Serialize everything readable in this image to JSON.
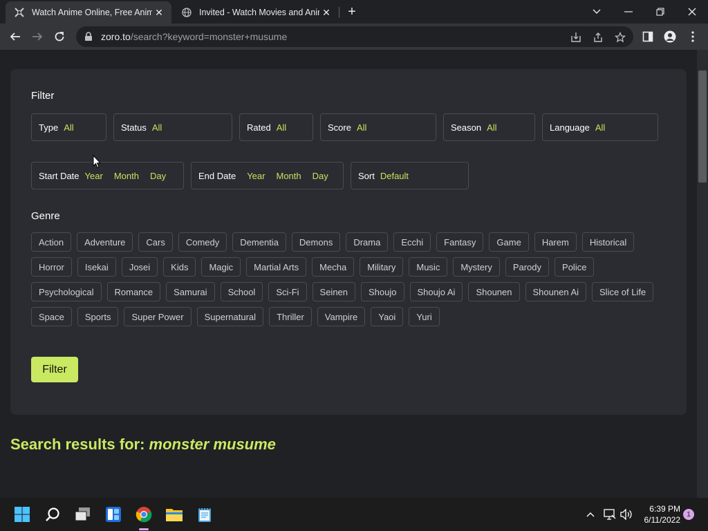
{
  "browser": {
    "tabs": [
      {
        "title": "Watch Anime Online, Free Anime",
        "icon": "zoro-favicon",
        "active": true
      },
      {
        "title": "Invited - Watch Movies and Anim",
        "icon": "globe-icon",
        "active": false
      }
    ],
    "url_host": "zoro.to",
    "url_path": "/search?keyword=monster+musume"
  },
  "filter": {
    "title": "Filter",
    "row1": [
      {
        "label": "Type",
        "value": "All"
      },
      {
        "label": "Status",
        "value": "All"
      },
      {
        "label": "Rated",
        "value": "All"
      },
      {
        "label": "Score",
        "value": "All"
      },
      {
        "label": "Season",
        "value": "All"
      },
      {
        "label": "Language",
        "value": "All"
      }
    ],
    "start_date": {
      "label": "Start Date",
      "year": "Year",
      "month": "Month",
      "day": "Day"
    },
    "end_date": {
      "label": "End Date",
      "year": "Year",
      "month": "Month",
      "day": "Day"
    },
    "sort": {
      "label": "Sort",
      "value": "Default"
    },
    "genre_title": "Genre",
    "genres": [
      [
        "Action",
        "Adventure",
        "Cars",
        "Comedy",
        "Dementia",
        "Demons",
        "Drama",
        "Ecchi",
        "Fantasy",
        "Game",
        "Harem",
        "Historical"
      ],
      [
        "Horror",
        "Isekai",
        "Josei",
        "Kids",
        "Magic",
        "Martial Arts",
        "Mecha",
        "Military",
        "Music",
        "Mystery",
        "Parody",
        "Police"
      ],
      [
        "Psychological",
        "Romance",
        "Samurai",
        "School",
        "Sci-Fi",
        "Seinen",
        "Shoujo",
        "Shoujo Ai",
        "Shounen",
        "Shounen Ai",
        "Slice of Life"
      ],
      [
        "Space",
        "Sports",
        "Super Power",
        "Supernatural",
        "Thriller",
        "Vampire",
        "Yaoi",
        "Yuri"
      ]
    ],
    "button_label": "Filter"
  },
  "results": {
    "prefix": "Search results for:",
    "keyword": "monster musume"
  },
  "taskbar": {
    "time": "6:39 PM",
    "date": "6/11/2022",
    "notification_count": "1"
  },
  "colors": {
    "accent": "#cae962",
    "page_bg": "#202125",
    "panel_bg": "#2a2c31"
  }
}
